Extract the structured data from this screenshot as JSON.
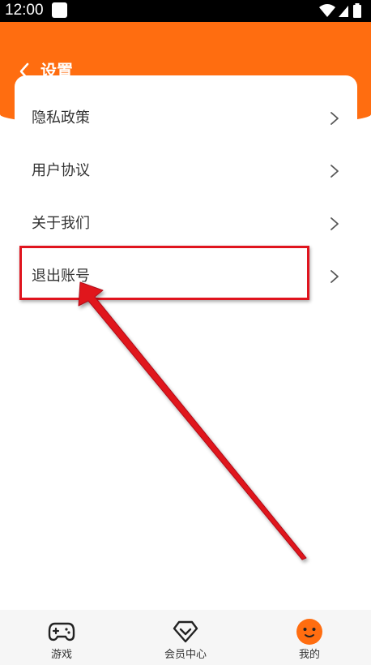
{
  "status_bar": {
    "time": "12:00"
  },
  "header": {
    "title": "设置"
  },
  "settings": {
    "items": [
      {
        "label": "隐私政策"
      },
      {
        "label": "用户协议"
      },
      {
        "label": "关于我们"
      },
      {
        "label": "退出账号"
      }
    ]
  },
  "tab_bar": {
    "tabs": [
      {
        "label": "游戏",
        "icon": "gamepad-icon"
      },
      {
        "label": "会员中心",
        "icon": "diamond-icon"
      },
      {
        "label": "我的",
        "icon": "smiley-face-icon"
      }
    ]
  },
  "colors": {
    "accent": "#ff6d10",
    "highlight": "#e0141e",
    "text": "#333333",
    "tab_bar_bg": "#f6f6f6"
  }
}
